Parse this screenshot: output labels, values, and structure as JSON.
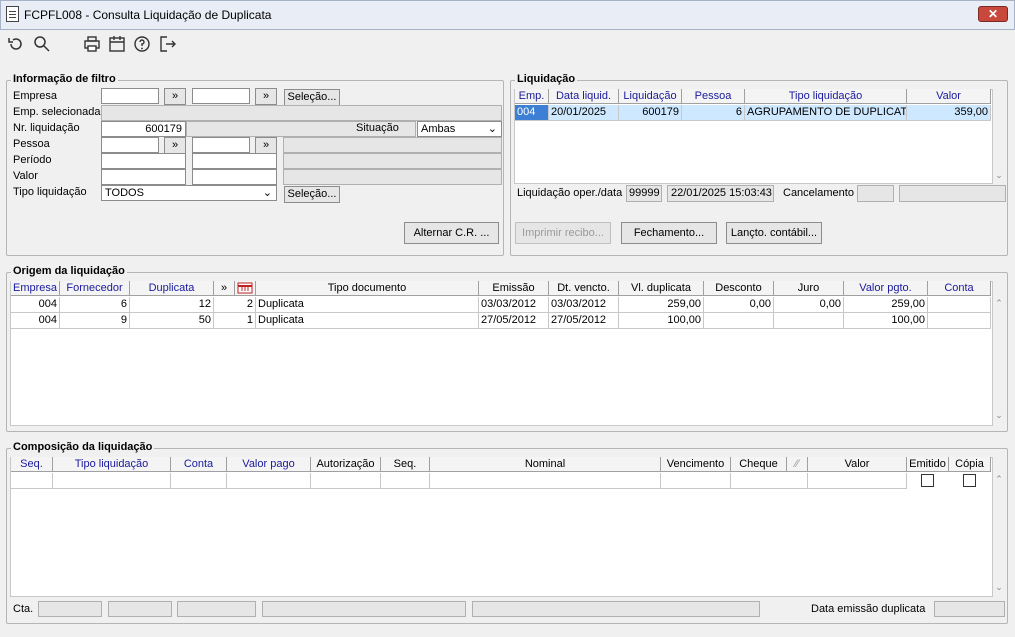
{
  "window": {
    "title": "FCPFL008 - Consulta Liquidação de Duplicata",
    "close": "✕"
  },
  "toolbar": [
    "refresh-icon",
    "search-icon",
    "print-icon",
    "calendar-icon",
    "help-icon",
    "exit-icon"
  ],
  "filtro": {
    "title": "Informação de filtro",
    "empresa_label": "Empresa",
    "emp_sel_label": "Emp. selecionada",
    "nr_liq_label": "Nr. liquidação",
    "nr_liq_value": "600179",
    "situacao_label": "Situação",
    "situacao_value": "Ambas",
    "pessoa_label": "Pessoa",
    "periodo_label": "Período",
    "valor_label": "Valor",
    "tipo_label": "Tipo liquidação",
    "tipo_value": "TODOS",
    "selecao": "Seleção...",
    "jump": "»",
    "alternar": "Alternar C.R. ..."
  },
  "liquidacao": {
    "title": "Liquidação",
    "headers": [
      "Emp.",
      "Data liquid.",
      "Liquidação",
      "Pessoa",
      "Tipo liquidação",
      "Valor"
    ],
    "row": [
      "004",
      "20/01/2025",
      "600179",
      "6",
      "AGRUPAMENTO DE DUPLICATA",
      "359,00"
    ],
    "oper_label": "Liquidação oper./data",
    "oper_user": "99999",
    "oper_date": "22/01/2025 15:03:43",
    "cancel_label": "Cancelamento",
    "btn_imprimir": "Imprimir recibo...",
    "btn_fechamento": "Fechamento...",
    "btn_lancto": "Lançto. contábil..."
  },
  "origem": {
    "title": "Origem da liquidação",
    "headers": [
      "Empresa",
      "Fornecedor",
      "Duplicata",
      "»",
      "",
      "Tipo documento",
      "Emissão",
      "Dt. vencto.",
      "Vl. duplicata",
      "Desconto",
      "Juro",
      "Valor  pgto.",
      "Conta"
    ],
    "rows": [
      [
        "004",
        "6",
        "12",
        "2",
        "Duplicata",
        "03/03/2012",
        "03/03/2012",
        "259,00",
        "0,00",
        "0,00",
        "259,00",
        ""
      ],
      [
        "004",
        "9",
        "50",
        "1",
        "Duplicata",
        "27/05/2012",
        "27/05/2012",
        "100,00",
        "",
        "",
        "100,00",
        ""
      ]
    ]
  },
  "composicao": {
    "title": "Composição da liquidação",
    "headers": [
      "Seq.",
      "Tipo liquidação",
      "Conta",
      "Valor pago",
      "Autorização",
      "Seq.",
      "Nominal",
      "Vencimento",
      "Cheque",
      "",
      "Valor",
      "Emitido",
      "Cópia"
    ],
    "cta_label": "Cta.",
    "data_emissao_label": "Data emissão duplicata"
  }
}
